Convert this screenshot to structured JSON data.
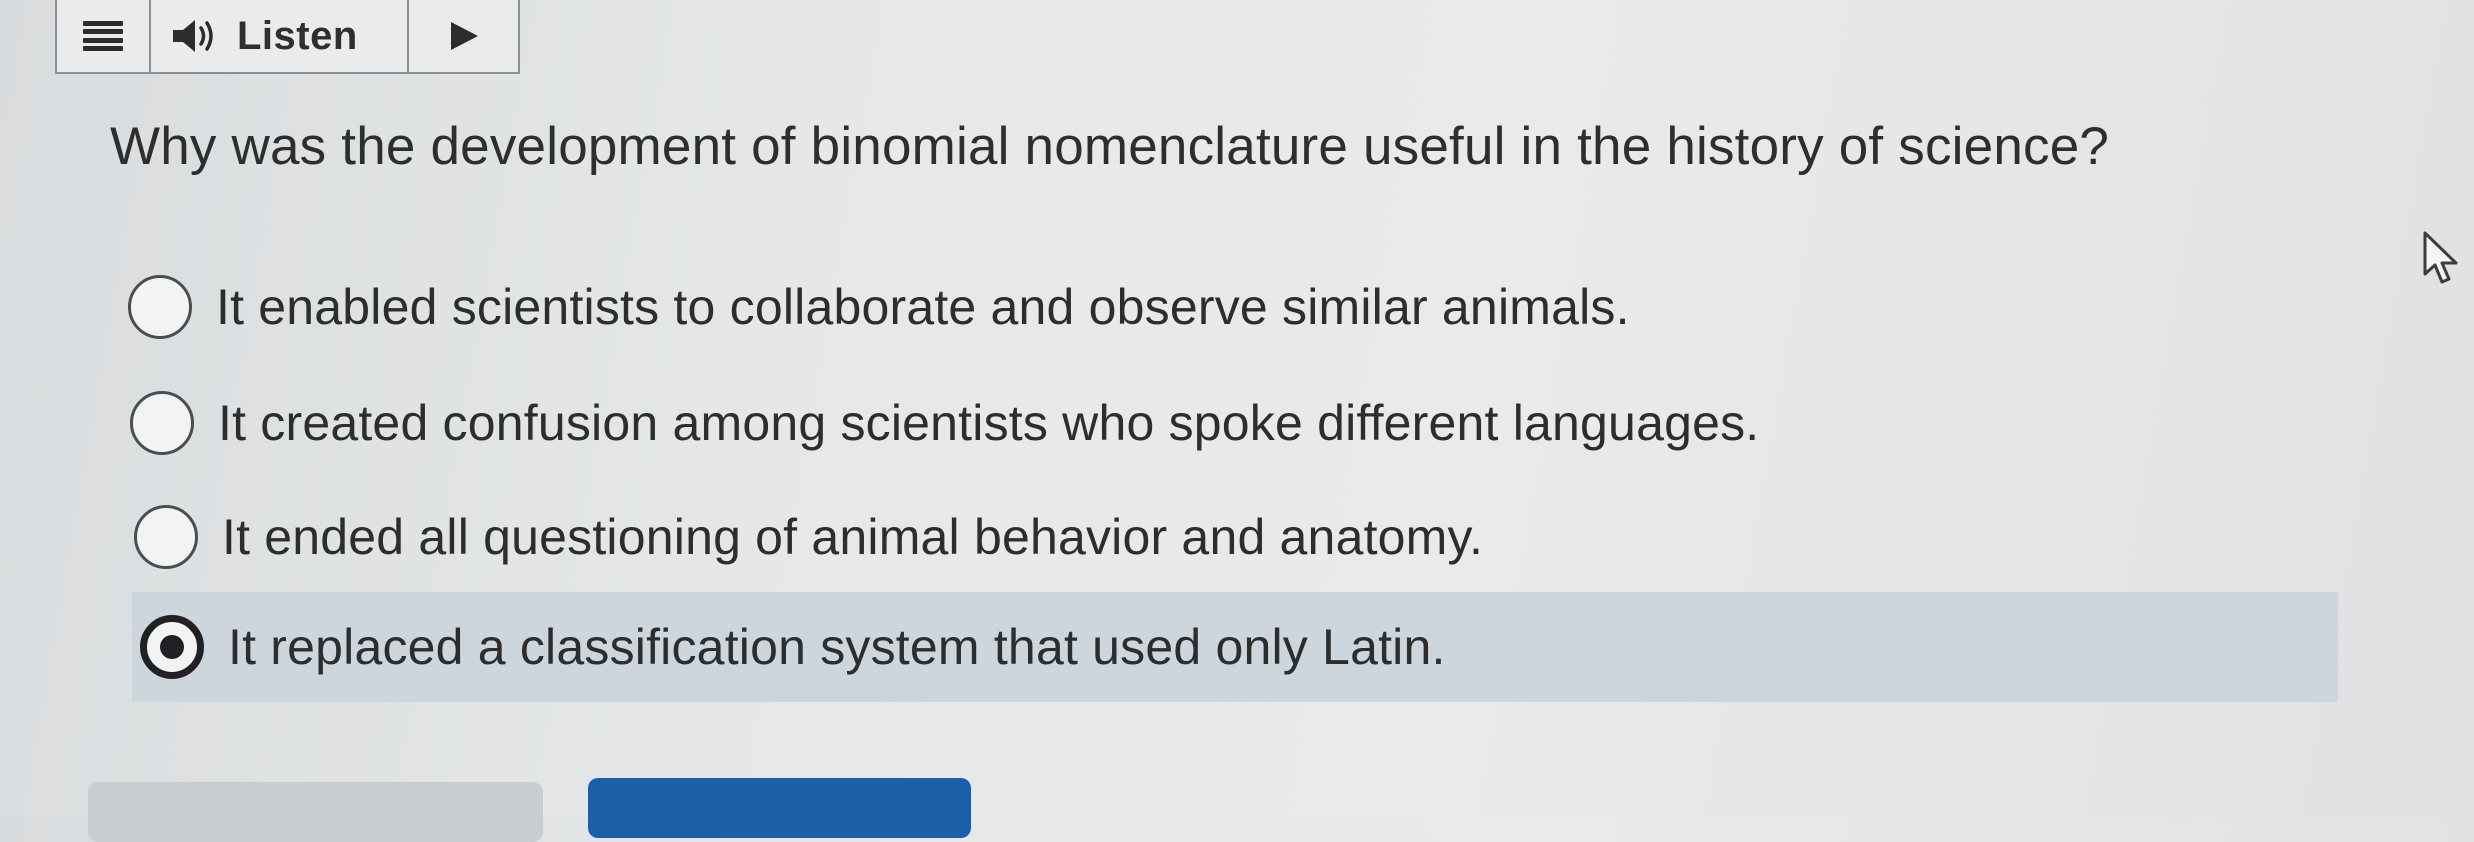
{
  "toolbar": {
    "listen_label": "Listen",
    "icons": [
      "menu-icon",
      "speaker-icon",
      "play-icon"
    ]
  },
  "question": {
    "text": "Why was the development of binomial nomenclature useful in the history of science?"
  },
  "options": [
    {
      "label": "It enabled scientists to collaborate and observe similar animals.",
      "selected": false
    },
    {
      "label": "It created confusion among scientists who spoke different languages.",
      "selected": false
    },
    {
      "label": "It ended all questioning of animal behavior and anatomy.",
      "selected": false
    },
    {
      "label": "It replaced a classification system that used only Latin.",
      "selected": true
    }
  ],
  "colors": {
    "selected_row": "#cdd6dc",
    "primary_button": "#1a5fa8",
    "secondary_button": "#c9cdd0",
    "text": "#2b2d2f"
  }
}
